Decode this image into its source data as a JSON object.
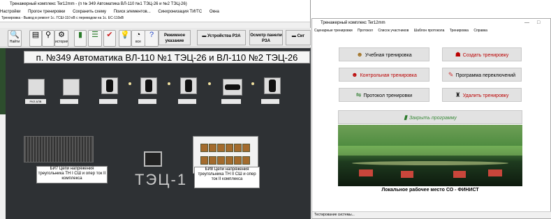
{
  "left_window": {
    "title": "Тренажерный комплекс Ter12mm - (п № 349 Автоматика ВЛ-110 №1 ТЭЦ-26 и №2 ТЭЦ-26)",
    "menu": [
      "Настройки",
      "Прогон тренировки",
      "Сохранить схему",
      "Поиск элементов...",
      "Синхронизация ТИ/ТС",
      "Окна"
    ],
    "status": "Тренировка - Вывод в ремонт 1с. ГСШ-110 кВ с переводом на 1с. ЕС-110кВ",
    "toolbar": {
      "b1": "Найти",
      "b2": "",
      "b3": "",
      "b4": "история",
      "b5": "",
      "b6": "",
      "b7": "",
      "b8": "",
      "b9": "все",
      "b10": "",
      "wide1": "Режимное указание",
      "wide2": "Устройства РЗА",
      "wide3": "Осмотр панели РЗА",
      "wide4": "Сиг"
    },
    "panel": {
      "title": "п. №349  Автоматика ВЛ-110 №1 ТЭЦ-26 и ВЛ-110 №2 ТЭЦ-26",
      "labels": [
        "РКЛ АПВ",
        "",
        "",
        "",
        "",
        "",
        "",
        ""
      ],
      "note_left": "БИ7 Цепи напряжения треугольника ТН I СШ и опер ток II комплекса",
      "note_right": "БИ8 Цепи напряжения треугольника ТН II СШ и опер ток II комплекса",
      "plate": "ТЭЦ-1"
    }
  },
  "right_window": {
    "title": "Тренажерный комплекс Ter12mm",
    "menu": [
      "Сценарные тренировки",
      "Протокол",
      "Список участников",
      "Шаблон протокола",
      "Тренировка",
      "Справка"
    ],
    "buttons": {
      "training": "Учебная тренировка",
      "create": "Создать тренировку",
      "control": "Контрольная тренировка",
      "switching": "Программа переключений",
      "protocol": "Протокол тренировки",
      "delete": "Удалить тренировку",
      "close": "Закрыть программу"
    },
    "caption": "Локальное рабочее место СО - ФИНИСТ",
    "status": "Тестирование системы..."
  }
}
